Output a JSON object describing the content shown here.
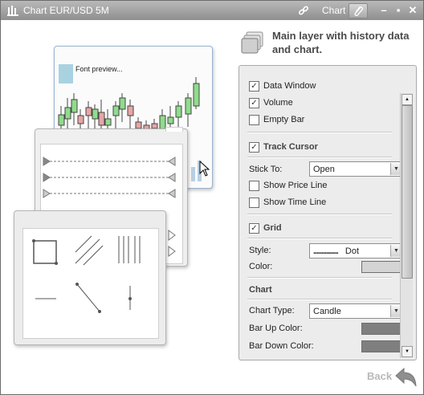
{
  "window": {
    "title": "Chart EUR/USD 5M",
    "chart_label": "Chart",
    "icons": [
      "chart-app-icon",
      "link-icon",
      "paperclip-icon",
      "minimize-icon",
      "maximize-icon",
      "close-icon"
    ]
  },
  "illustration": {
    "font_preview": "Font preview..."
  },
  "header": {
    "text": "Main layer with history data and chart."
  },
  "panel": {
    "data_window": {
      "label": "Data Window",
      "checked": true
    },
    "volume": {
      "label": "Volume",
      "checked": true
    },
    "empty_bar": {
      "label": "Empty Bar",
      "checked": false
    },
    "track_cursor": {
      "label": "Track Cursor",
      "checked": true
    },
    "stick_to": {
      "label": "Stick To:",
      "value": "Open"
    },
    "show_price_line": {
      "label": "Show Price Line",
      "checked": false
    },
    "show_time_line": {
      "label": "Show Time Line",
      "checked": false
    },
    "grid": {
      "label": "Grid",
      "checked": true
    },
    "style": {
      "label": "Style:",
      "value": "Dot",
      "dots": "..............."
    },
    "color": {
      "label": "Color:",
      "value": "#d4d4d4"
    },
    "chart_section": "Chart",
    "chart_type": {
      "label": "Chart Type:",
      "value": "Candle"
    },
    "bar_up_color": {
      "label": "Bar Up Color:",
      "value": "#7f7f7f"
    },
    "bar_down_color": {
      "label": "Bar Down Color:",
      "value": "#7f7f7f"
    }
  },
  "footer": {
    "back_label": "Back"
  }
}
